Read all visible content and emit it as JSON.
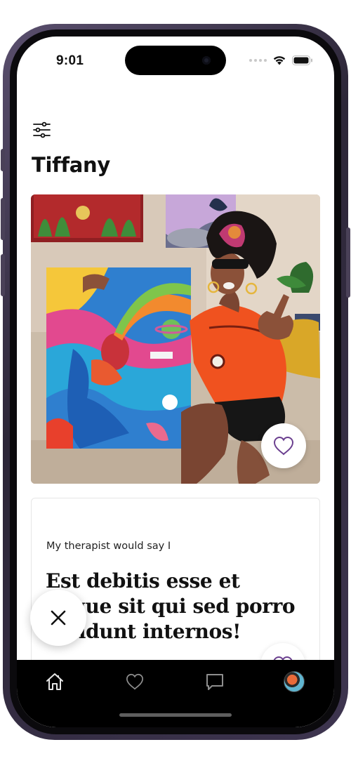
{
  "status_bar": {
    "time": "9:01"
  },
  "header": {
    "title": "Tiffany"
  },
  "icons": {
    "filter": "sliders-icon",
    "like": "heart-icon",
    "skip": "close-icon",
    "home": "home-icon",
    "likes_tab": "heart-icon",
    "messages": "chat-bubble-icon",
    "profile": "avatar"
  },
  "photo": {
    "description_alt": "profile-photo"
  },
  "prompt": {
    "label": "My therapist would say I",
    "answer": "Est debitis esse et neque sit qui sed porro incidunt internos!"
  },
  "colors": {
    "accent": "#6b3f8f",
    "tabbar_bg": "#000000",
    "frame": "#2c2637"
  }
}
